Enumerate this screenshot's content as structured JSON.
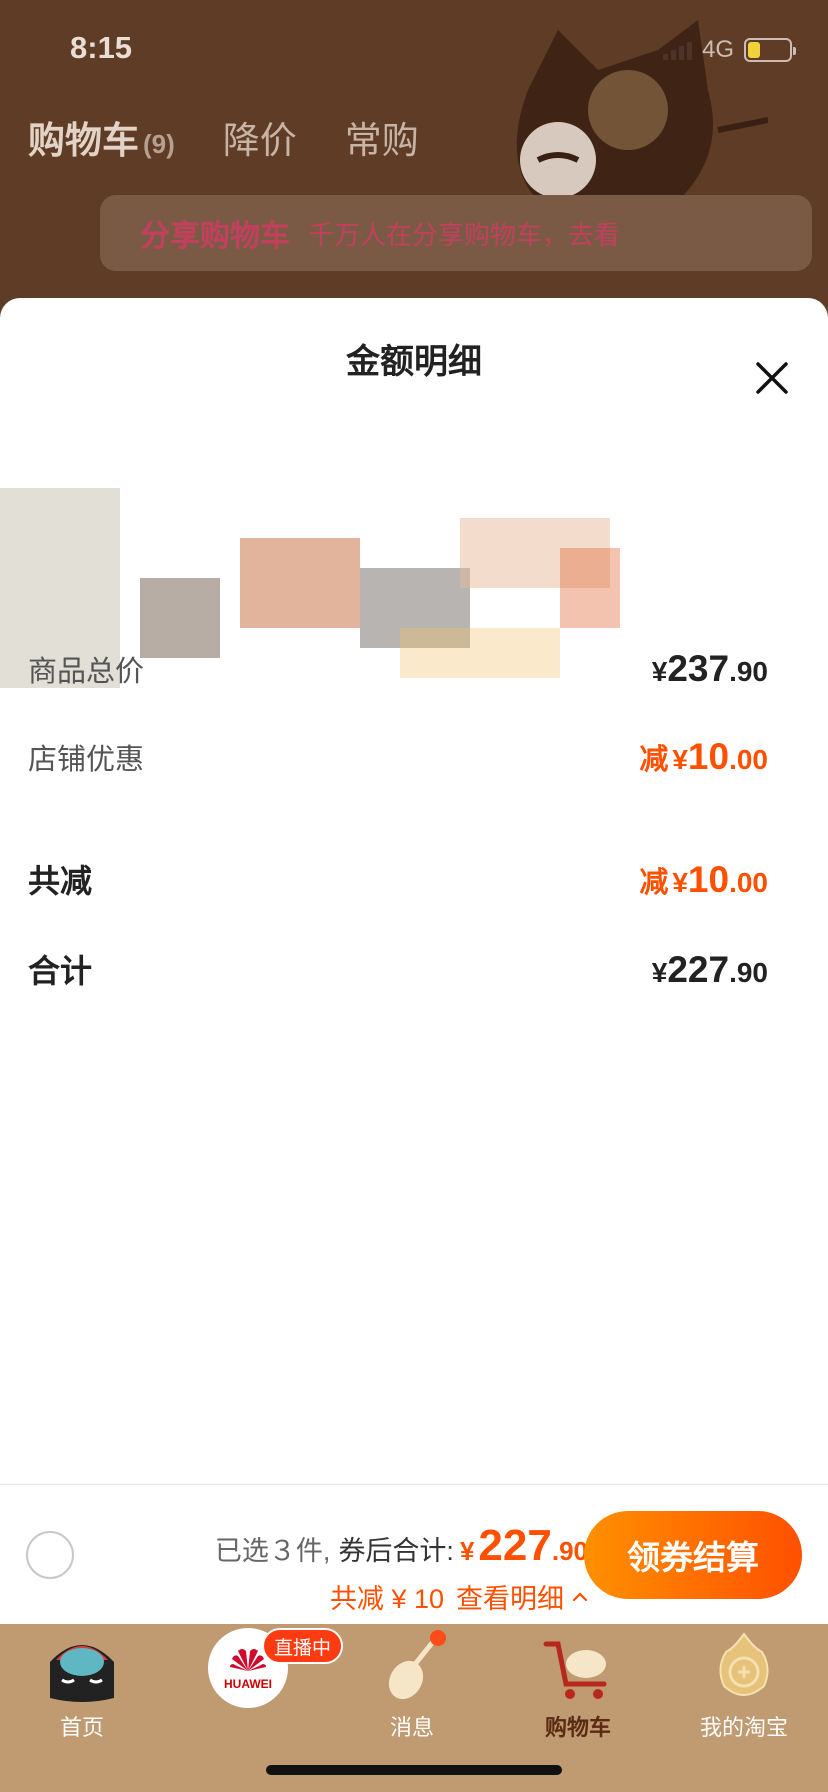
{
  "status_bar": {
    "time": "8:15",
    "network": "4G",
    "battery_level": 0.3
  },
  "top_tabs": [
    {
      "label": "购物车",
      "count": "(9)",
      "active": true
    },
    {
      "label": "降价",
      "active": false
    },
    {
      "label": "常购",
      "active": false
    }
  ],
  "share_banner": {
    "title": "分享购物车",
    "subtitle": "千万人在分享购物车，去看"
  },
  "sheet": {
    "title": "金额明细",
    "rows": {
      "goods_total": {
        "label": "商品总价",
        "yen": "¥",
        "int": "237",
        "dec": ".90"
      },
      "shop_discount": {
        "label": "店铺优惠",
        "minus": "减",
        "yen": "¥",
        "int": "10",
        "dec": ".00"
      },
      "total_discount": {
        "label": "共减",
        "minus": "减",
        "yen": "¥",
        "int": "10",
        "dec": ".00"
      },
      "grand_total": {
        "label": "合计",
        "yen": "¥",
        "int": "227",
        "dec": ".90"
      }
    }
  },
  "checkout": {
    "selected_text": "已选３件,",
    "coupon_total_label": "券后合计:",
    "yen": "¥",
    "total_int": "227",
    "total_dec": ".90",
    "discount_text": "共减 ¥ 10",
    "detail_link": "查看明细",
    "button_label": "领券结算"
  },
  "tab_bar": {
    "items": [
      {
        "label": "首页",
        "icon": "home-cat-icon"
      },
      {
        "label": "HUAWEI",
        "icon": "huawei-logo-icon"
      },
      {
        "label": "消息",
        "icon": "message-pipa-icon"
      },
      {
        "label": "购物车",
        "icon": "cart-icon",
        "active": true
      },
      {
        "label": "我的淘宝",
        "icon": "my-taobao-icon"
      }
    ],
    "live_badge": "直播中"
  },
  "colors": {
    "accent": "#ff5000",
    "tab_bar_bg": "#c09a71",
    "overlay_bg": "#5e3c26"
  }
}
